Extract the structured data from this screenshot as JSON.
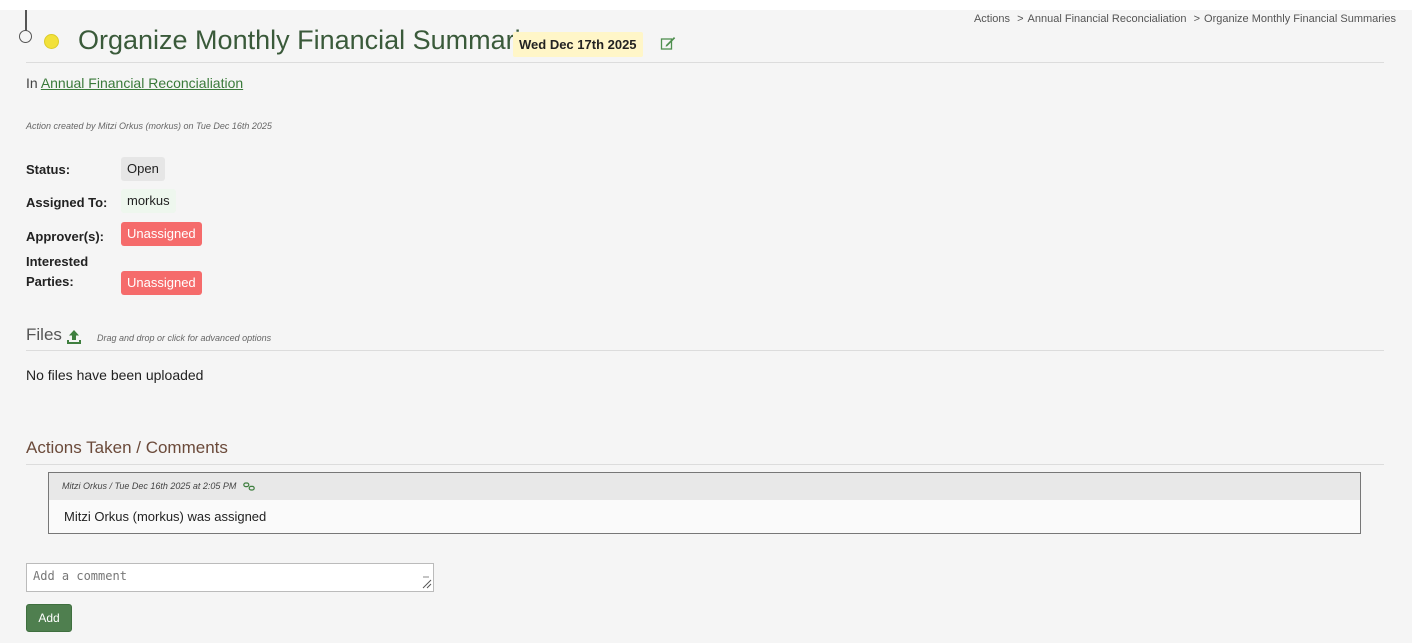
{
  "header": {
    "title": "Organize Monthly Financial Summaries",
    "due_date": "Wed Dec 17th 2025",
    "status_color": "#f2e13a"
  },
  "breadcrumb": {
    "items": [
      "Actions",
      "Annual Financial Reconcialiation",
      "Organize Monthly Financial Summaries"
    ],
    "separator": ">"
  },
  "parent": {
    "prefix": "In",
    "link": "Annual Financial Reconcialiation"
  },
  "created": "Action created by Mitzi Orkus (morkus) on Tue Dec 16th 2025",
  "fields": {
    "status": {
      "label": "Status:",
      "value": "Open"
    },
    "assigned": {
      "label": "Assigned To:",
      "value": "morkus"
    },
    "approvers": {
      "label": "Approver(s):",
      "value": "Unassigned"
    },
    "interested": {
      "label_line1": "Interested",
      "label_line2": "Parties:",
      "value": "Unassigned"
    }
  },
  "files": {
    "title": "Files",
    "hint": "Drag and drop or click for advanced options",
    "empty": "No files have been uploaded"
  },
  "comments": {
    "title": "Actions Taken / Comments",
    "entries": [
      {
        "meta": "Mitzi Orkus / Tue Dec 16th 2025 at 2:05 PM",
        "text": "Mitzi Orkus (morkus) was assigned"
      }
    ],
    "placeholder": "Add a comment",
    "add_label": "Add"
  },
  "colors": {
    "accent_green": "#4f7f4f",
    "unassigned_red": "#f56b6b",
    "due_bg": "#fff6c8"
  },
  "icons": {
    "edit": "edit-icon",
    "upload": "upload-icon",
    "permalink": "link-icon"
  }
}
